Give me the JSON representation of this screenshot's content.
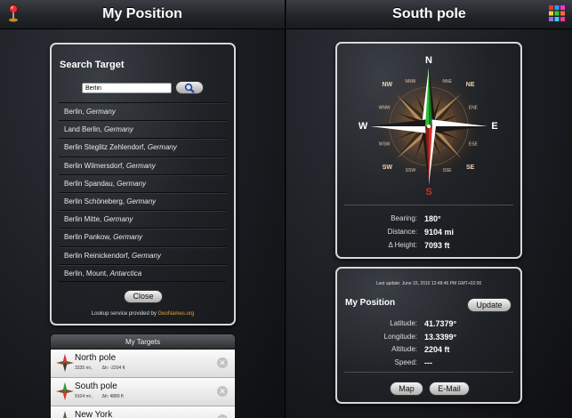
{
  "left": {
    "title": "My Position",
    "search": {
      "heading": "Search Target",
      "query": "Berlin",
      "results": [
        {
          "city": "Berlin,",
          "country": "Germany"
        },
        {
          "city": "Land Berlin,",
          "country": "Germany"
        },
        {
          "city": "Berlin Steglitz Zehlendorf,",
          "country": "Germany"
        },
        {
          "city": "Berlin Wilmersdorf,",
          "country": "Germany"
        },
        {
          "city": "Berlin Spandau,",
          "country": "Germany"
        },
        {
          "city": "Berlin Schöneberg,",
          "country": "Germany"
        },
        {
          "city": "Berlin Mitte,",
          "country": "Germany"
        },
        {
          "city": "Berlin Pankow,",
          "country": "Germany"
        },
        {
          "city": "Berlin Reinickendorf,",
          "country": "Germany"
        },
        {
          "city": "Berlin, Mount,",
          "country": "Antarctica"
        }
      ],
      "close_label": "Close",
      "lookup_text": "Lookup service provided by",
      "lookup_link": "GeoNames.org"
    },
    "targets": {
      "header": "My Targets",
      "items": [
        {
          "name": "North pole",
          "dist": "3335 mi ,",
          "dh": "Δh: -2204 ft"
        },
        {
          "name": "South pole",
          "dist": "9104 mi ,",
          "dh": "Δh: 4889 ft"
        },
        {
          "name": "New York",
          "dist": "",
          "dh": ""
        }
      ]
    },
    "icons": {
      "app": "red-pin-icon",
      "target": "compass-rose-icon",
      "delete": "delete-icon",
      "search": "magnifier-icon"
    }
  },
  "right": {
    "title": "South pole",
    "compass": {
      "cardinal": [
        "N",
        "E",
        "S",
        "W"
      ],
      "intercardinal": [
        "NE",
        "SE",
        "SW",
        "NW"
      ],
      "secondary": [
        "NNE",
        "ENE",
        "ESE",
        "SSE",
        "SSW",
        "WSW",
        "WNW",
        "NNW"
      ],
      "heading_deg": 180,
      "needle_color": "#d0302a",
      "north_color": "#2fbf3a"
    },
    "stats": {
      "bearing_label": "Bearing:",
      "bearing_value": "180°",
      "distance_label": "Distance:",
      "distance_value": "9104 mi",
      "height_label": "Δ Height:",
      "height_value": "7093 ft"
    },
    "position": {
      "updated": "Last update: June 15, 2010 12:48:46 PM GMT+02:00",
      "heading": "My Position",
      "update_label": "Update",
      "latitude_label": "Latitude:",
      "latitude_value": "41.7379°",
      "longitude_label": "Longitude:",
      "longitude_value": "13.3399°",
      "altitude_label": "Altitude:",
      "altitude_value": "2204 ft",
      "speed_label": "Speed:",
      "speed_value": "---",
      "map_label": "Map",
      "email_label": "E-Mail"
    },
    "icons": {
      "menu": "color-grid-icon"
    }
  }
}
